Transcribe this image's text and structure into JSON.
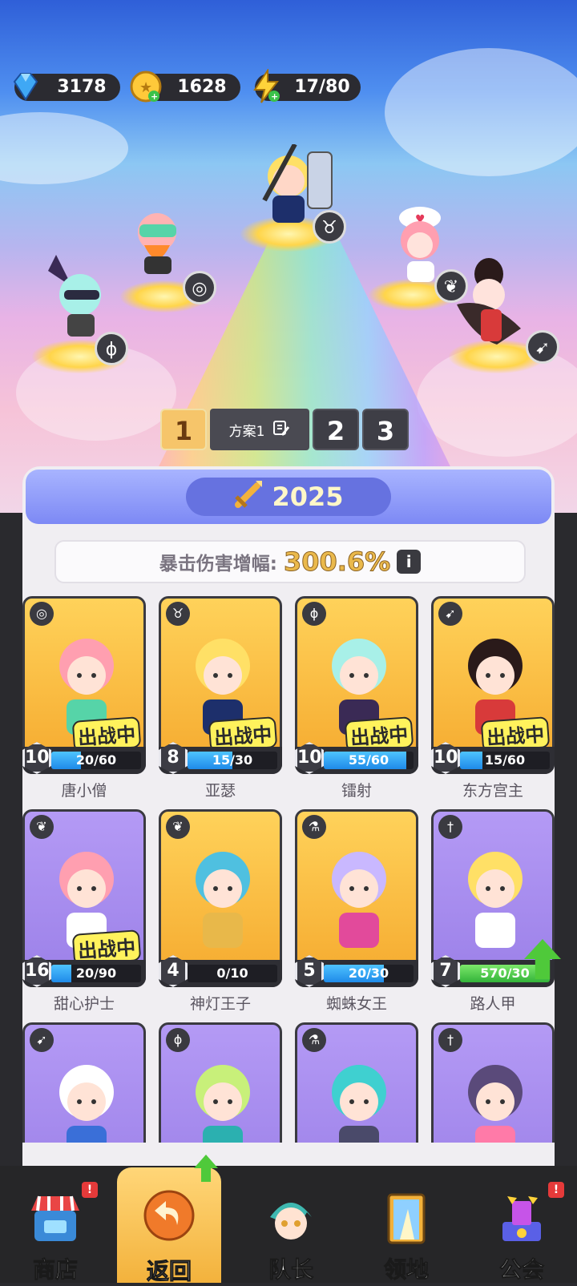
{
  "currencies": [
    {
      "icon": "diamond-icon",
      "value": "3178"
    },
    {
      "icon": "gold-coin-icon",
      "value": "1628"
    },
    {
      "icon": "energy-bolt-icon",
      "value": "17/80"
    }
  ],
  "plan_bar": {
    "plans": [
      "1",
      "2",
      "3"
    ],
    "active_plan": "1",
    "plan_name": "方案1"
  },
  "power": {
    "value": "2025"
  },
  "crit": {
    "label": "暴击伤害增幅:",
    "value": "300.6%"
  },
  "cards": [
    {
      "name": "唐小僧",
      "level": "10",
      "progress": "20/60",
      "ratio": 0.33,
      "bg": "gold",
      "type_icon": "spiral-icon",
      "deployed": true,
      "deploy_label": "出战中",
      "bar": "blue"
    },
    {
      "name": "亚瑟",
      "level": "8",
      "progress": "15/30",
      "ratio": 0.5,
      "bg": "gold",
      "type_icon": "bull-icon",
      "deployed": true,
      "deploy_label": "出战中",
      "bar": "blue"
    },
    {
      "name": "镭射",
      "level": "10",
      "progress": "55/60",
      "ratio": 0.92,
      "bg": "gold",
      "type_icon": "staff-icon",
      "deployed": true,
      "deploy_label": "出战中",
      "bar": "blue"
    },
    {
      "name": "东方宫主",
      "level": "10",
      "progress": "15/60",
      "ratio": 0.25,
      "bg": "gold",
      "type_icon": "bow-icon",
      "deployed": true,
      "deploy_label": "出战中",
      "bar": "blue"
    },
    {
      "name": "甜心护士",
      "level": "16",
      "progress": "20/90",
      "ratio": 0.22,
      "bg": "purple",
      "type_icon": "wings-icon",
      "deployed": true,
      "deploy_label": "出战中",
      "bar": "blue"
    },
    {
      "name": "神灯王子",
      "level": "4",
      "progress": "0/10",
      "ratio": 0,
      "bg": "gold",
      "type_icon": "wings-icon",
      "deployed": false,
      "deploy_label": "",
      "bar": "blue"
    },
    {
      "name": "蜘蛛女王",
      "level": "5",
      "progress": "20/30",
      "ratio": 0.67,
      "bg": "gold",
      "type_icon": "potion-icon",
      "deployed": false,
      "deploy_label": "",
      "bar": "blue"
    },
    {
      "name": "路人甲",
      "level": "7",
      "progress": "570/30",
      "ratio": 1,
      "bg": "purple",
      "type_icon": "sword-icon",
      "deployed": false,
      "deploy_label": "",
      "bar": "green",
      "upgrade": true
    },
    {
      "name": "",
      "level": "",
      "progress": "",
      "ratio": 0,
      "bg": "purple",
      "type_icon": "bow-icon",
      "deployed": false,
      "deploy_label": "",
      "bar": "blue"
    },
    {
      "name": "",
      "level": "",
      "progress": "",
      "ratio": 0,
      "bg": "purple",
      "type_icon": "staff-icon",
      "deployed": false,
      "deploy_label": "",
      "bar": "blue"
    },
    {
      "name": "",
      "level": "",
      "progress": "",
      "ratio": 0,
      "bg": "purple",
      "type_icon": "potion-icon",
      "deployed": false,
      "deploy_label": "",
      "bar": "blue"
    },
    {
      "name": "",
      "level": "",
      "progress": "",
      "ratio": 0,
      "bg": "purple",
      "type_icon": "sword-icon",
      "deployed": false,
      "deploy_label": "",
      "bar": "blue"
    }
  ],
  "nav": [
    {
      "label": "商店",
      "icon": "shop-icon",
      "badge": "!"
    },
    {
      "label": "返回",
      "icon": "return-arrow-icon",
      "badge": ""
    },
    {
      "label": "队长",
      "icon": "captain-avatar-icon",
      "badge": ""
    },
    {
      "label": "领地",
      "icon": "territory-door-icon",
      "badge": ""
    },
    {
      "label": "公会",
      "icon": "guild-icon",
      "badge": "!"
    }
  ],
  "colors": {
    "accent": "#f6c56a",
    "power_header": "#7d89f5",
    "upgrade_green": "#4fc93a",
    "alert_red": "#e53a3a"
  }
}
